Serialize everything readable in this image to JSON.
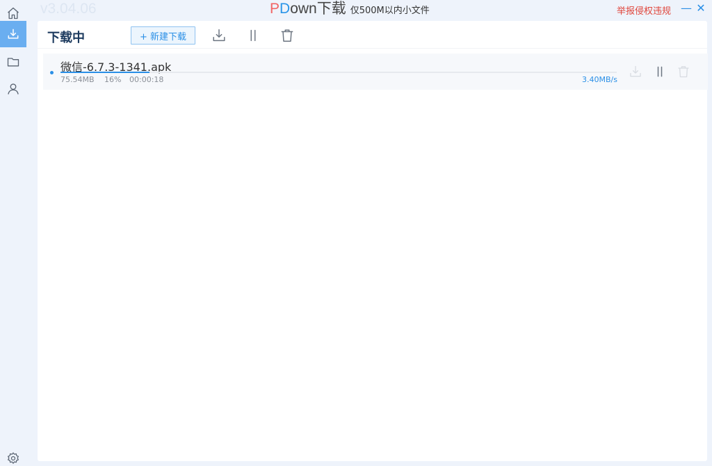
{
  "app": {
    "version": "v3.04.06",
    "logo_p": "P",
    "logo_d": "D",
    "logo_rest": "own下载",
    "tagline": "仅500M以内小文件",
    "report_link": "举报侵权违规",
    "minimize_glyph": "—",
    "close_glyph": "✕"
  },
  "sidebar": {
    "items": [
      {
        "icon": "home-icon",
        "active": false
      },
      {
        "icon": "download-icon",
        "active": true
      },
      {
        "icon": "folder-icon",
        "active": false
      },
      {
        "icon": "user-icon",
        "active": false
      }
    ],
    "bottom": {
      "icon": "gear-icon"
    }
  },
  "toolbar": {
    "title": "下载中",
    "new_download_label": "+ 新建下载",
    "icons": [
      "download-all-icon",
      "pause-all-icon",
      "delete-all-icon"
    ]
  },
  "downloads": [
    {
      "filename": "微信-6.7.3-1341.apk",
      "size": "75.54MB",
      "percent": "16%",
      "progress": 0.16,
      "elapsed": "00:00:18",
      "speed": "3.40MB/s"
    }
  ],
  "colors": {
    "accent": "#2a8fe6",
    "sidebar_active": "#6aaef0",
    "report_red": "#e0463c",
    "logo_red": "#f26464"
  }
}
